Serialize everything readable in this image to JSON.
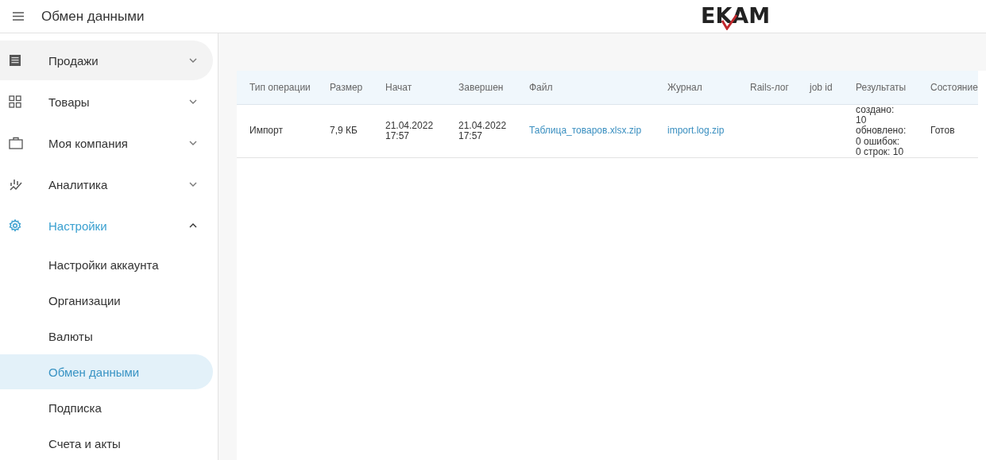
{
  "header": {
    "title": "Обмен данными",
    "logo": "EKAM"
  },
  "sidebar": {
    "items": [
      {
        "label": "Продажи",
        "expanded": false,
        "hovered": true
      },
      {
        "label": "Товары",
        "expanded": false,
        "hovered": false
      },
      {
        "label": "Моя компания",
        "expanded": false,
        "hovered": false
      },
      {
        "label": "Аналитика",
        "expanded": false,
        "hovered": false
      },
      {
        "label": "Настройки",
        "expanded": true,
        "hovered": false,
        "children": [
          {
            "label": "Настройки аккаунта",
            "selected": false
          },
          {
            "label": "Организации",
            "selected": false
          },
          {
            "label": "Валюты",
            "selected": false
          },
          {
            "label": "Обмен данными",
            "selected": true
          },
          {
            "label": "Подписка",
            "selected": false
          },
          {
            "label": "Счета и акты",
            "selected": false
          }
        ]
      }
    ]
  },
  "table": {
    "columns": [
      "Тип операции",
      "Размер",
      "Начат",
      "Завершен",
      "Файл",
      "Журнал",
      "Rails-лог",
      "job id",
      "Результаты",
      "Состояние"
    ],
    "rows": [
      {
        "cells": [
          {
            "kind": "text",
            "text": "Импорт"
          },
          {
            "kind": "text",
            "text": "7,9 КБ"
          },
          {
            "kind": "text",
            "text": "21.04.2022 17:57"
          },
          {
            "kind": "text",
            "text": "21.04.2022 17:57"
          },
          {
            "kind": "link",
            "text": "Таблица_товаров.xlsx.zip"
          },
          {
            "kind": "link",
            "text": "import.log.zip"
          },
          {
            "kind": "empty"
          },
          {
            "kind": "empty"
          },
          {
            "kind": "text",
            "text": "создано: 10 обновлено: 0 ошибок: 0 строк: 10"
          },
          {
            "kind": "text",
            "text": "Готов"
          }
        ]
      }
    ]
  }
}
